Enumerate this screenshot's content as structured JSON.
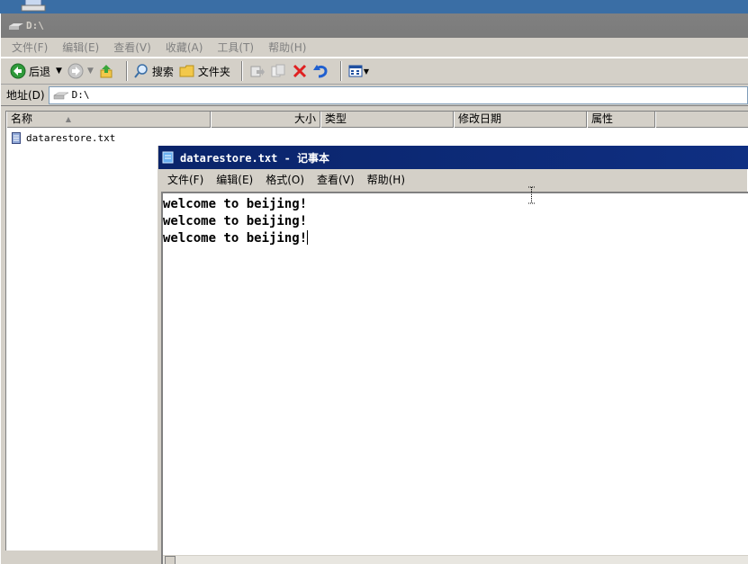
{
  "explorer": {
    "title": "D:\\",
    "menu": [
      "文件(F)",
      "编辑(E)",
      "查看(V)",
      "收藏(A)",
      "工具(T)",
      "帮助(H)"
    ],
    "toolbar": {
      "back": "后退",
      "search": "搜索",
      "folders": "文件夹"
    },
    "address_label": "地址(D)",
    "address_value": "D:\\",
    "columns": {
      "name": "名称",
      "sort_indicator": "▲",
      "size": "大小",
      "type": "类型",
      "modified": "修改日期",
      "attributes": "属性"
    },
    "files": [
      {
        "name": "datarestore.txt"
      }
    ]
  },
  "notepad": {
    "title": "datarestore.txt - 记事本",
    "menu": [
      "文件(F)",
      "编辑(E)",
      "格式(O)",
      "查看(V)",
      "帮助(H)"
    ],
    "lines": [
      "welcome to beijing!",
      "welcome to beijing!",
      "welcome to beijing!"
    ]
  },
  "colors": {
    "desktop": "#3a6ea5",
    "active_titlebar": "#0a246a",
    "inactive_titlebar": "#808080",
    "face": "#d4d0c8"
  }
}
